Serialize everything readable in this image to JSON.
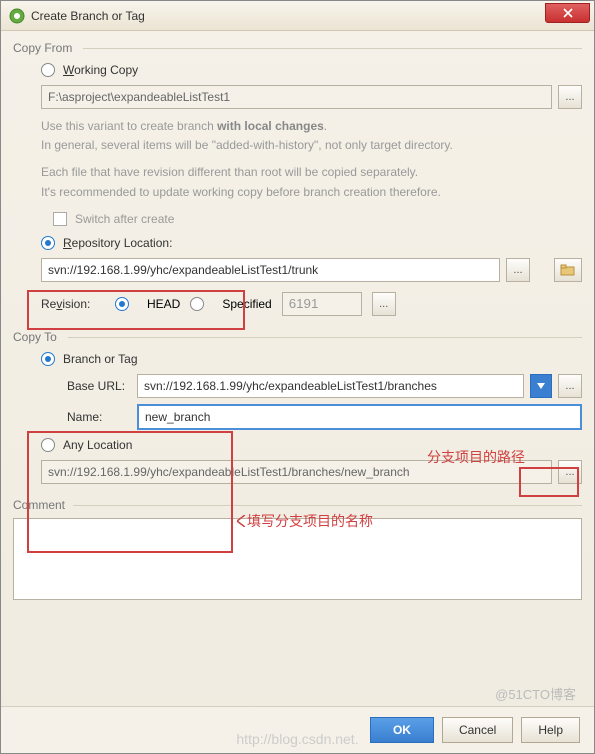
{
  "titlebar": {
    "title": "Create Branch or Tag"
  },
  "copyFrom": {
    "legend": "Copy From",
    "workingCopy": {
      "label": "Working Copy",
      "accel": "W"
    },
    "path": "F:\\asproject\\expandeableListTest1",
    "help1a": "Use this variant to create branch ",
    "help1b": "with local changes",
    "help1c": ".",
    "help2": "In general, several items will be \"added-with-history\", not only target directory.",
    "help3": "Each file that have revision different than root will be copied separately.",
    "help4": "It's recommended to update working copy before branch creation therefore.",
    "switchAfter": "Switch after create",
    "repoLocation": {
      "label": "Repository Location:",
      "accel": "R"
    },
    "repoUrl": "svn://192.168.1.99/yhc/expandeableListTest1/trunk",
    "revisionLabel": "Revision:",
    "revHead": "HEAD",
    "revSpecified": "Specified",
    "revNum": "6191"
  },
  "copyTo": {
    "legend": "Copy To",
    "branchOrTag": "Branch or Tag",
    "baseUrlLabel": "Base URL:",
    "baseUrl": "svn://192.168.1.99/yhc/expandeableListTest1/branches",
    "nameLabel": "Name:",
    "nameValue": "new_branch",
    "anyLocation": "Any Location",
    "anyLocationUrl": "svn://192.168.1.99/yhc/expandeableListTest1/branches/new_branch"
  },
  "comment": {
    "legend": "Comment"
  },
  "buttons": {
    "ok": "OK",
    "cancel": "Cancel",
    "help": "Help"
  },
  "annotations": {
    "pathNote": "分支项目的路径",
    "nameNote": "填写分支项目的名称"
  },
  "watermark": "http://blog.csdn.net.",
  "watermark2": "@51CTO博客"
}
